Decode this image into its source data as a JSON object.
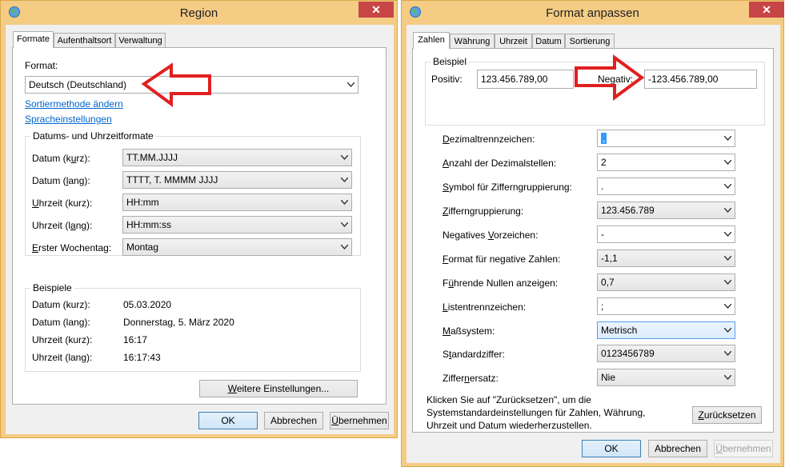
{
  "region": {
    "title": "Region",
    "close": "✕",
    "tabs": [
      "Formate",
      "Aufenthaltsort",
      "Verwaltung"
    ],
    "format_label": "Format:",
    "format_value": "Deutsch (Deutschland)",
    "link_sort": "Sortiermethode ändern",
    "link_lang": "Spracheinstellungen",
    "datetime_group": "Datums- und Uhrzeitformate",
    "rows": [
      {
        "label": "Datum (kurz):",
        "value": "TT.MM.JJJJ"
      },
      {
        "label": "Datum (lang):",
        "value": "TTTT, T. MMMM JJJJ"
      },
      {
        "label": "Uhrzeit (kurz):",
        "value": "HH:mm"
      },
      {
        "label": "Uhrzeit (lang):",
        "value": "HH:mm:ss"
      },
      {
        "label": "Erster Wochentag:",
        "value": "Montag"
      }
    ],
    "examples_group": "Beispiele",
    "examples": [
      {
        "label": "Datum (kurz):",
        "value": "05.03.2020"
      },
      {
        "label": "Datum (lang):",
        "value": "Donnerstag, 5. März 2020"
      },
      {
        "label": "Uhrzeit (kurz):",
        "value": "16:17"
      },
      {
        "label": "Uhrzeit (lang):",
        "value": "16:17:43"
      }
    ],
    "more_settings": "Weitere Einstellungen...",
    "ok": "OK",
    "cancel": "Abbrechen",
    "apply": "Übernehmen"
  },
  "format": {
    "title": "Format anpassen",
    "close": "✕",
    "tabs": [
      "Zahlen",
      "Währung",
      "Uhrzeit",
      "Datum",
      "Sortierung"
    ],
    "example_group": "Beispiel",
    "positive_label": "Positiv:",
    "positive_value": "123.456.789,00",
    "negative_label": "Negativ:",
    "negative_value": "-123.456.789,00",
    "rows": [
      {
        "label": "Dezimaltrennzeichen:",
        "value": ","
      },
      {
        "label": "Anzahl der Dezimalstellen:",
        "value": "2"
      },
      {
        "label": "Symbol für Zifferngruppierung:",
        "value": "."
      },
      {
        "label": "Zifferngruppierung:",
        "value": "123.456.789"
      },
      {
        "label": "Negatives Vorzeichen:",
        "value": "-"
      },
      {
        "label": "Format für negative Zahlen:",
        "value": "-1,1"
      },
      {
        "label": "Führende Nullen anzeigen:",
        "value": "0,7"
      },
      {
        "label": "Listentrennzeichen:",
        "value": ";"
      },
      {
        "label": "Maßsystem:",
        "value": "Metrisch"
      },
      {
        "label": "Standardziffer:",
        "value": "0123456789"
      },
      {
        "label": "Ziffernersatz:",
        "value": "Nie"
      }
    ],
    "reset_text": "Klicken Sie auf \"Zurücksetzen\", um die Systemstandardeinstellungen für Zahlen, Währung, Uhrzeit und Datum wiederherzustellen.",
    "reset_btn": "Zurücksetzen",
    "ok": "OK",
    "cancel": "Abbrechen",
    "apply": "Übernehmen"
  },
  "colors": {
    "frame": "#f5cc84",
    "close": "#c74545",
    "arrow": "#e02020",
    "link": "#0066cc"
  }
}
